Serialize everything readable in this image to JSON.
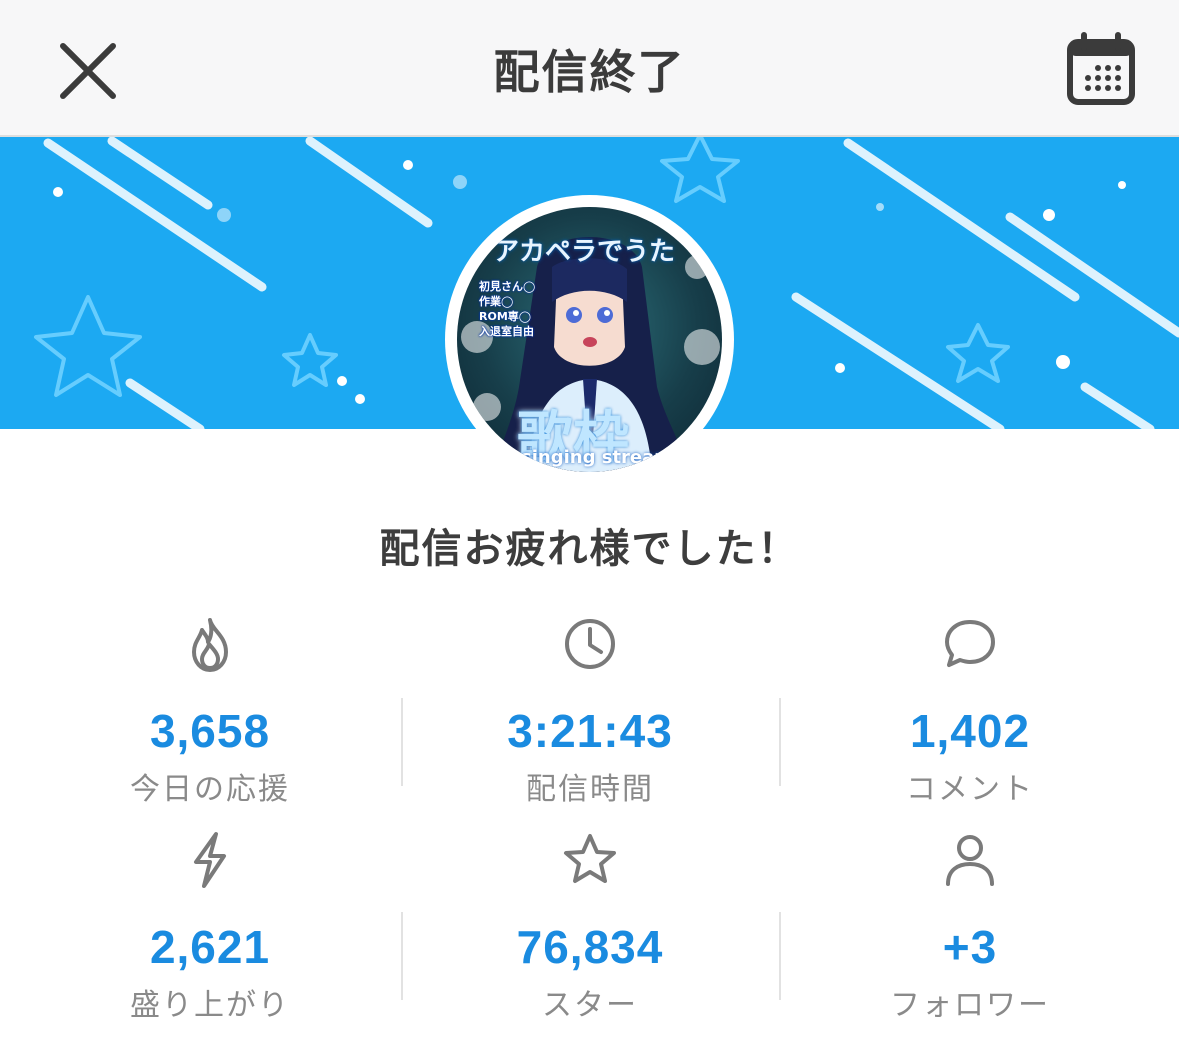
{
  "header": {
    "title": "配信終了",
    "close_icon": "close-icon",
    "calendar_icon": "calendar-icon"
  },
  "thumbnail": {
    "caption": "アカペラでうた",
    "notes": "初見さん◯\n作業◯\nROM専◯\n入退室自由",
    "logo": "歌枠",
    "sub": "singing stream"
  },
  "message": "配信お疲れ様でした！",
  "stats": [
    {
      "icon": "flame-icon",
      "value": "3,658",
      "label": "今日の応援"
    },
    {
      "icon": "clock-icon",
      "value": "3:21:43",
      "label": "配信時間"
    },
    {
      "icon": "comment-icon",
      "value": "1,402",
      "label": "コメント"
    },
    {
      "icon": "lightning-icon",
      "value": "2,621",
      "label": "盛り上がり"
    },
    {
      "icon": "star-icon",
      "value": "76,834",
      "label": "スター"
    },
    {
      "icon": "person-icon",
      "value": "+3",
      "label": "フォロワー"
    }
  ],
  "colors": {
    "banner": "#1ca9f2",
    "value": "#1a8be0",
    "label": "#8a8a8a"
  }
}
